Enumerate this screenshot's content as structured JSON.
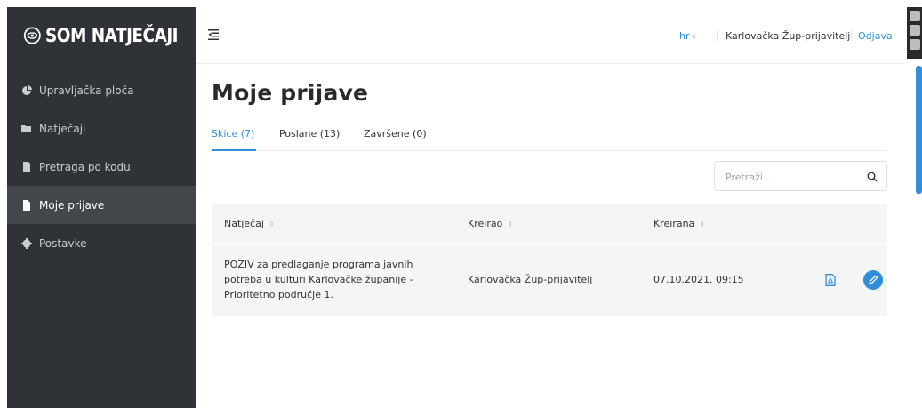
{
  "brand": {
    "name": "SOM NATJEČAJI"
  },
  "sidebar": {
    "items": [
      {
        "label": "Upravljačka ploča",
        "icon": "pie-chart-icon",
        "active": false
      },
      {
        "label": "Natječaji",
        "icon": "folder-icon",
        "active": false
      },
      {
        "label": "Pretraga po kodu",
        "icon": "document-icon",
        "active": false
      },
      {
        "label": "Moje prijave",
        "icon": "file-icon",
        "active": true
      },
      {
        "label": "Postavke",
        "icon": "gear-icon",
        "active": false
      }
    ]
  },
  "topbar": {
    "lang": "hr",
    "user": "Karlovačka Žup-prijavitelj",
    "logout": "Odjava"
  },
  "page": {
    "title": "Moje prijave",
    "tabs": [
      {
        "label": "Skice (7)",
        "active": true
      },
      {
        "label": "Poslane (13)",
        "active": false
      },
      {
        "label": "Završene (0)",
        "active": false
      }
    ]
  },
  "search": {
    "placeholder": "Pretraži ...",
    "value": ""
  },
  "table": {
    "columns": [
      "Natječaj",
      "Kreirao",
      "Kreirana"
    ],
    "rows": [
      {
        "natjecaj_line1": "POZIV za predlaganje programa javnih",
        "natjecaj_line2": "potreba u kulturi Karlovačke županije -",
        "natjecaj_line3": "Prioritetno područje 1.",
        "kreirao": "Karlovačka Žup-prijavitelj",
        "kreirana": "07.10.2021. 09:15"
      }
    ]
  },
  "colors": {
    "accent": "#2f8fd8",
    "sidebar": "#2f3337",
    "sidebar_active": "#42474c",
    "row_bg": "#f4f5f6"
  }
}
